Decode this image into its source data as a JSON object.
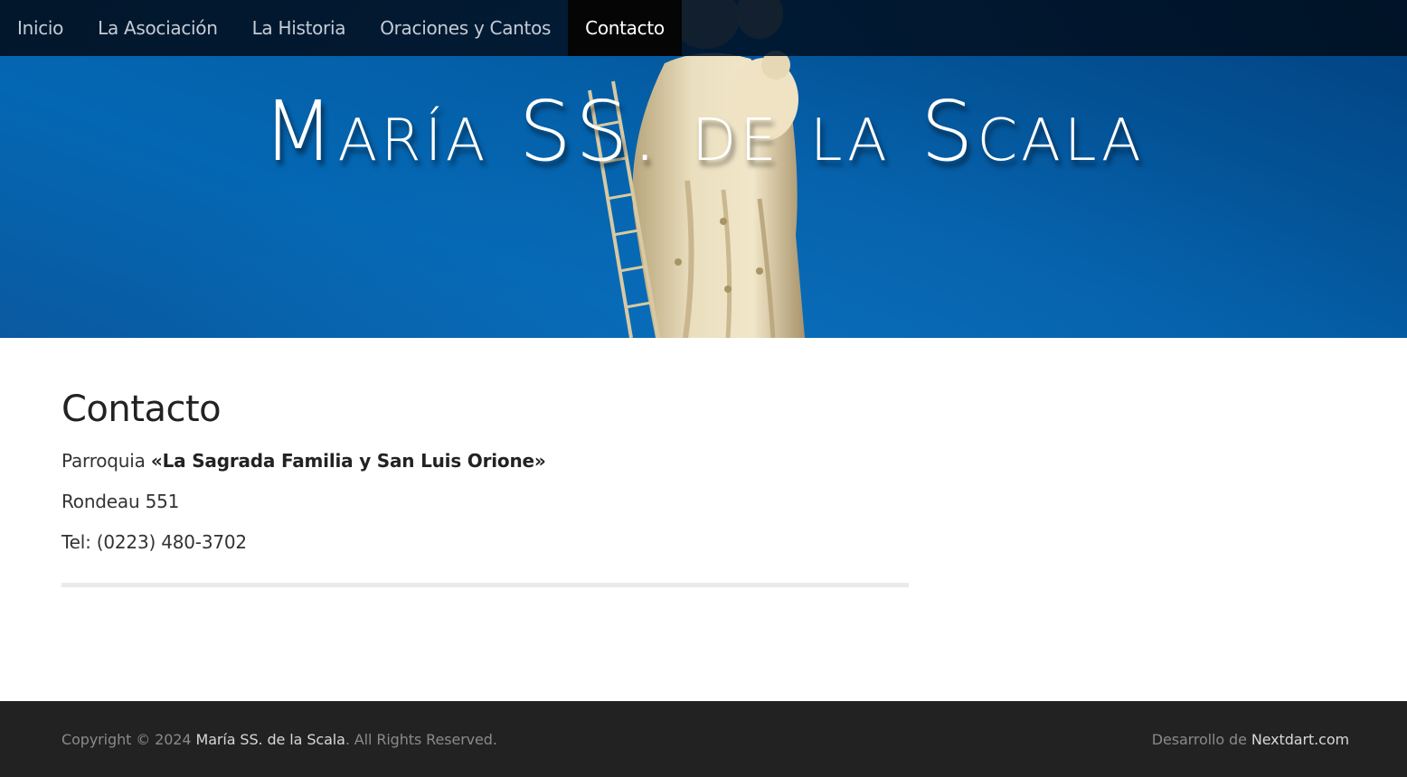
{
  "nav": {
    "items": [
      {
        "label": "Inicio"
      },
      {
        "label": "La Asociación"
      },
      {
        "label": "La Historia"
      },
      {
        "label": "Oraciones y Cantos"
      },
      {
        "label": "Contacto"
      }
    ],
    "active": "Contacto"
  },
  "header": {
    "site_title": "María SS. de la Scala"
  },
  "main": {
    "heading": "Contacto",
    "parish_prefix": "Parroquia",
    "parish_name": "«La Sagrada Familia y San Luis Orione»",
    "address": "Rondeau 551",
    "phone": "Tel: (0223) 480-3702"
  },
  "footer": {
    "copyright_prefix": "Copyright © 2024",
    "site_link": "María SS. de la Scala",
    "rights": ". All Rights Reserved.",
    "dev_prefix": "Desarrollo de",
    "dev_link": "Nextdart.com"
  },
  "colors": {
    "nav_bg": "#021020",
    "sky_blue": "#045ea6",
    "footer_bg": "#222222",
    "statue": "#e8dcb8"
  }
}
